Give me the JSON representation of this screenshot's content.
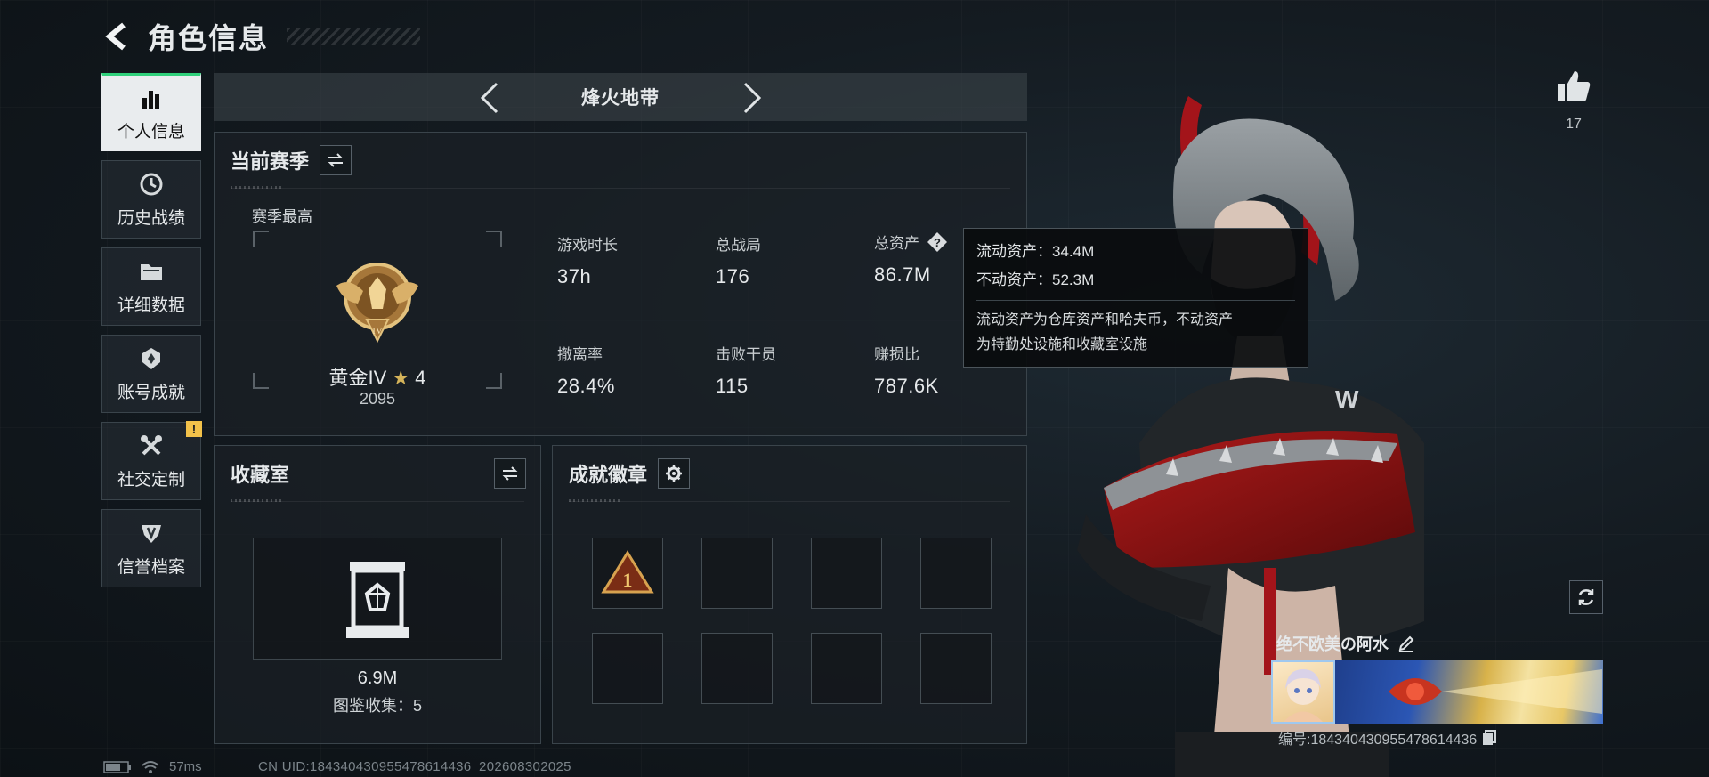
{
  "header": {
    "title": "角色信息"
  },
  "sidebar": {
    "items": [
      {
        "label": "个人信息",
        "icon": "bar-chart-icon",
        "active": true
      },
      {
        "label": "历史战绩",
        "icon": "clock-icon",
        "active": false
      },
      {
        "label": "详细数据",
        "icon": "folder-icon",
        "active": false
      },
      {
        "label": "账号成就",
        "icon": "trophy-icon",
        "active": false
      },
      {
        "label": "社交定制",
        "icon": "tools-icon",
        "active": false,
        "badge": "!"
      },
      {
        "label": "信誉档案",
        "icon": "shield-icon",
        "active": false
      }
    ]
  },
  "mode": {
    "title": "烽火地带"
  },
  "season": {
    "title": "当前赛季",
    "best_label": "赛季最高",
    "rank_name": "黄金IV",
    "rank_stars": "4",
    "rank_score": "2095",
    "stats": [
      {
        "label": "游戏时长",
        "value": "37h"
      },
      {
        "label": "总战局",
        "value": "176"
      },
      {
        "label": "总资产",
        "value": "86.7M"
      },
      {
        "label": "撤离率",
        "value": "28.4%"
      },
      {
        "label": "击败干员",
        "value": "115"
      },
      {
        "label": "赚损比",
        "value": "787.6K"
      }
    ]
  },
  "tooltip": {
    "liquid": "流动资产：34.4M",
    "fixed": "不动资产：52.3M",
    "desc_line1": "流动资产为仓库资产和哈夫币，不动资产",
    "desc_line2": "为特勤处设施和收藏室设施"
  },
  "collection": {
    "title": "收藏室",
    "value": "6.9M",
    "count_text": "图鉴收集：5"
  },
  "badges": {
    "title": "成就徽章",
    "first_badge_text": "1"
  },
  "profile": {
    "like_count": "17",
    "player_name": "绝不欧美の阿水",
    "player_id": "编号:18434043095547861443​6"
  },
  "status": {
    "ping": "57ms",
    "uid": "CN UID:18434043095547861443​6_202608302025"
  },
  "colors": {
    "accent": "#2fd07a",
    "warning": "#f2c14a",
    "gold": "#d4b35a"
  }
}
